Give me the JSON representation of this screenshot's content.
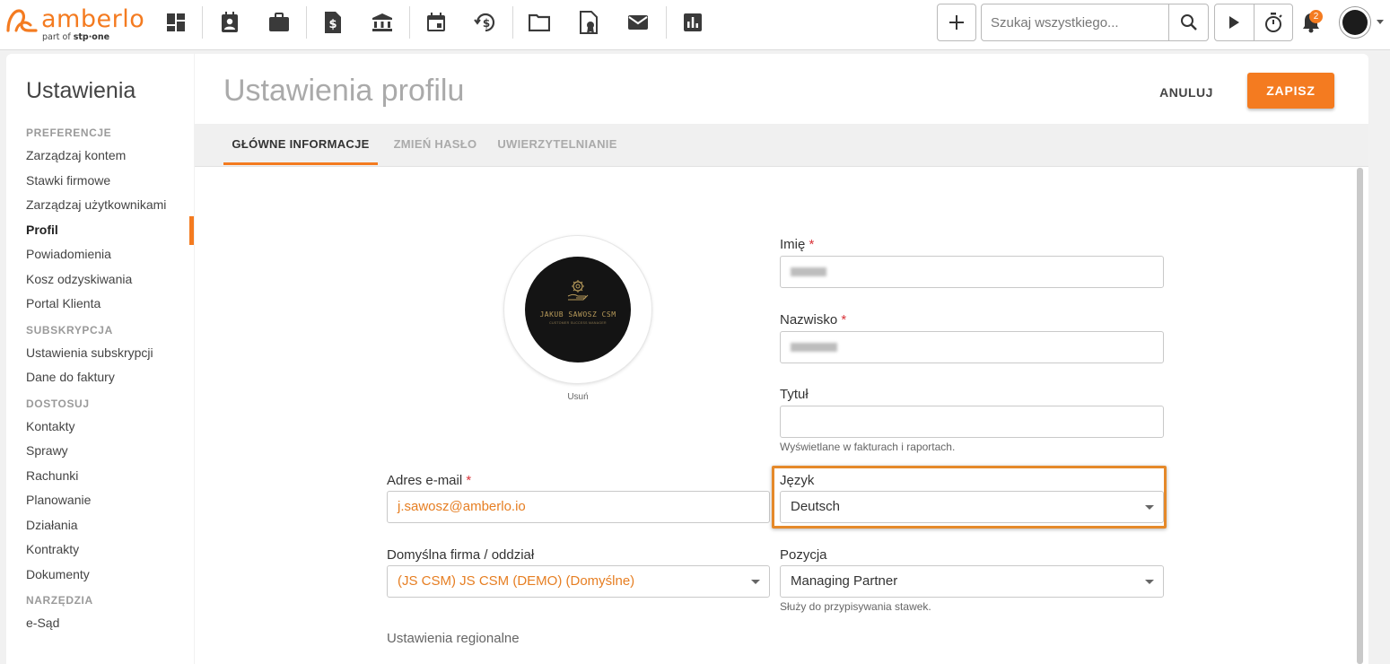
{
  "brand": {
    "name": "amberlo",
    "sub_prefix": "part of",
    "sub_brand": "stp·one",
    "color": "#f47b20"
  },
  "topnav": {
    "icons": [
      "dashboard-icon",
      "contacts-icon",
      "matters-icon",
      "invoices-icon",
      "bank-icon",
      "calendar-icon",
      "time-history-icon",
      "folder-icon",
      "certificate-icon",
      "mail-icon",
      "reports-icon"
    ],
    "search_placeholder": "Szukaj wszystkiego...",
    "notifications_count": "2"
  },
  "sidebar": {
    "title": "Ustawienia",
    "sections": [
      {
        "label": "PREFERENCJE",
        "items": [
          "Zarządzaj kontem",
          "Stawki firmowe",
          "Zarządzaj użytkownikami",
          "Profil",
          "Powiadomienia",
          "Kosz odzyskiwania",
          "Portal Klienta"
        ]
      },
      {
        "label": "SUBSKRYPCJA",
        "items": [
          "Ustawienia subskrypcji",
          "Dane do faktury"
        ]
      },
      {
        "label": "DOSTOSUJ",
        "items": [
          "Kontakty",
          "Sprawy",
          "Rachunki",
          "Planowanie",
          "Działania",
          "Kontrakty",
          "Dokumenty"
        ]
      },
      {
        "label": "NARZĘDZIA",
        "items": [
          "e-Sąd"
        ]
      }
    ],
    "active_item": "Profil"
  },
  "page": {
    "title": "Ustawienia profilu",
    "cancel_label": "ANULUJ",
    "save_label": "ZAPISZ"
  },
  "tabs": [
    {
      "label": "GŁÓWNE INFORMACJE",
      "active": true
    },
    {
      "label": "ZMIEŃ HASŁO",
      "active": false
    },
    {
      "label": "UWIERZYTELNIANIE",
      "active": false
    }
  ],
  "profile": {
    "photo_name": "JAKUB SAWOSZ CSM",
    "photo_subtitle": "CUSTOMER SUCCESS MANAGER",
    "remove_label": "Usuń"
  },
  "form": {
    "first_name": {
      "label": "Imię",
      "required": "*"
    },
    "last_name": {
      "label": "Nazwisko",
      "required": "*"
    },
    "title": {
      "label": "Tytuł",
      "value": "",
      "hint": "Wyświetlane w fakturach i raportach."
    },
    "email": {
      "label": "Adres e-mail",
      "required": "*",
      "value": "j.sawosz@amberlo.io"
    },
    "language": {
      "label": "Język",
      "value": "Deutsch"
    },
    "default_firm": {
      "label": "Domyślna firma / oddział",
      "value": "(JS CSM) JS CSM (DEMO) (Domyślne)"
    },
    "position": {
      "label": "Pozycja",
      "value": "Managing Partner",
      "hint": "Służy do przypisywania stawek."
    },
    "regional_label": "Ustawienia regionalne"
  }
}
